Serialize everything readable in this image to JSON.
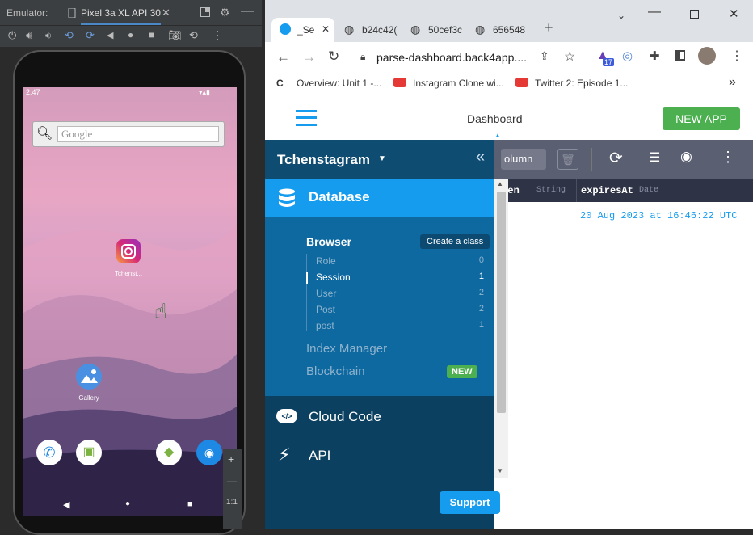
{
  "emulator": {
    "label": "Emulator:",
    "device": "Pixel 3a XL API 30",
    "phone": {
      "time": "2:47",
      "search_placeholder": "Google",
      "apps": [
        {
          "label": "Tchenst..."
        },
        {
          "label": "Gallery"
        }
      ],
      "zoom": {
        "plus": "+",
        "minus": "—",
        "ratio": "1:1"
      }
    }
  },
  "browser": {
    "tabs": [
      {
        "label": "_Se"
      },
      {
        "label": "b24c42("
      },
      {
        "label": "50cef3c"
      },
      {
        "label": "656548"
      }
    ],
    "url": "parse-dashboard.back4app....",
    "extension_badge": "17",
    "bookmarks": [
      {
        "label": "Overview: Unit 1 -..."
      },
      {
        "label": "Instagram Clone wi..."
      },
      {
        "label": "Twitter 2: Episode 1..."
      }
    ],
    "bookmarks_more": "»"
  },
  "dashboard": {
    "nav_title": "Dashboard",
    "new_app": "NEW APP",
    "app_name": "Tchenstagram",
    "sidebar": {
      "database": "Database",
      "browser": "Browser",
      "create_class": "Create a class",
      "classes": [
        {
          "name": "Role",
          "count": "0"
        },
        {
          "name": "Session",
          "count": "1"
        },
        {
          "name": "User",
          "count": "2"
        },
        {
          "name": "Post",
          "count": "2"
        },
        {
          "name": "post",
          "count": "1"
        }
      ],
      "index_manager": "Index Manager",
      "blockchain": "Blockchain",
      "new_badge": "NEW",
      "cloud_code": "Cloud Code",
      "api": "API",
      "support": "Support"
    },
    "toolbar": {
      "column_label": "olumn"
    },
    "grid": {
      "columns": [
        {
          "name": "oken",
          "type": "String"
        },
        {
          "name": "expiresAt",
          "type": "Date"
        }
      ],
      "rows": [
        {
          "expiresAt": "20 Aug 2023 at 16:46:22 UTC"
        }
      ]
    }
  },
  "colors": {
    "accent": "#169cee",
    "new_app": "#4caf50",
    "sidebar": "#0e69a1"
  }
}
